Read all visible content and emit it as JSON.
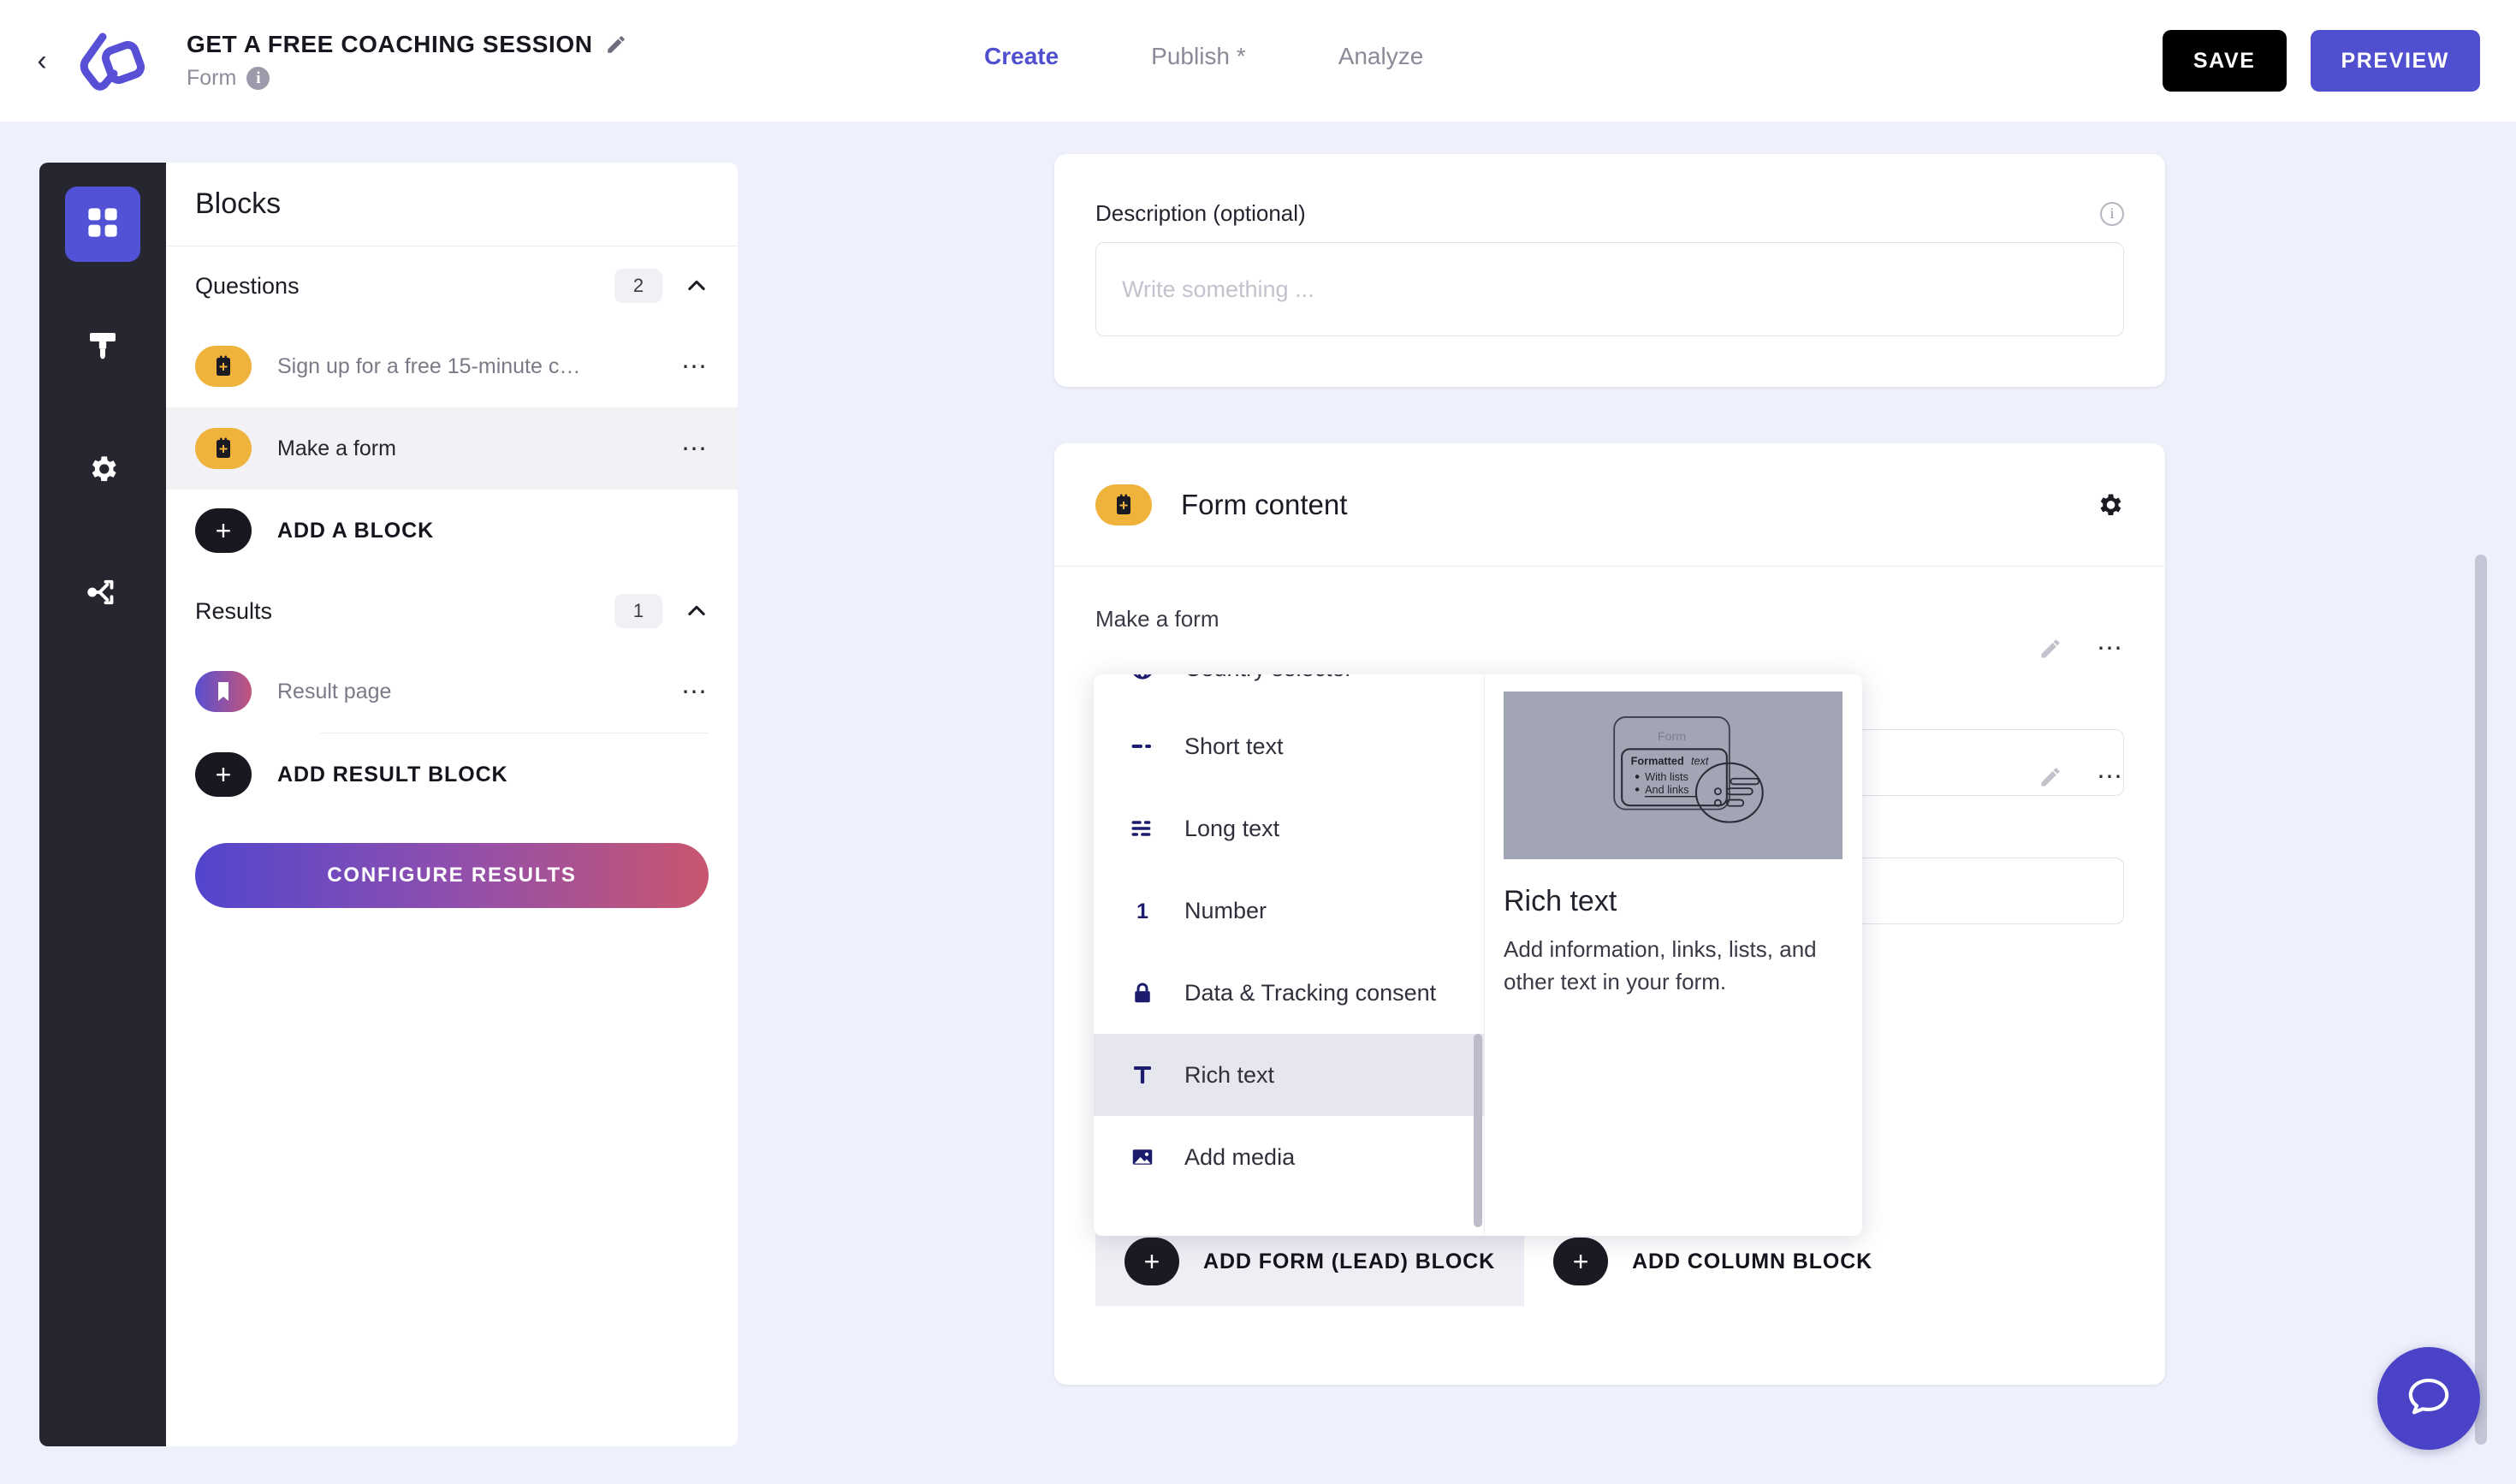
{
  "header": {
    "back_icon": "chevron-left-icon",
    "logo_icon": "brand-logo-icon",
    "title": "GET A FREE COACHING SESSION",
    "title_edit_icon": "pencil-icon",
    "subtitle": "Form",
    "subtitle_info_icon": "info-icon",
    "tabs": [
      {
        "label": "Create",
        "active": true
      },
      {
        "label": "Publish *",
        "active": false
      },
      {
        "label": "Analyze",
        "active": false
      }
    ],
    "save_label": "SAVE",
    "preview_label": "PREVIEW",
    "accent_color": "#4f4fd0",
    "save_color": "#000000"
  },
  "rail": {
    "items": [
      {
        "icon": "grid-blocks-icon",
        "active": true
      },
      {
        "icon": "paint-brush-icon",
        "active": false
      },
      {
        "icon": "gear-icon",
        "active": false
      },
      {
        "icon": "share-branch-icon",
        "active": false
      }
    ]
  },
  "blocks_panel": {
    "title": "Blocks",
    "questions": {
      "label": "Questions",
      "count": "2",
      "collapse_icon": "chevron-up-icon",
      "items": [
        {
          "label": "Sign up for a free 15-minute c…",
          "icon": "form-block-icon",
          "selected": false,
          "menu_icon": "ellipsis-icon"
        },
        {
          "label": "Make a form",
          "icon": "form-block-icon",
          "selected": true,
          "menu_icon": "ellipsis-icon"
        }
      ],
      "add_label": "ADD A BLOCK",
      "add_icon": "plus-icon"
    },
    "results": {
      "label": "Results",
      "count": "1",
      "collapse_icon": "chevron-up-icon",
      "items": [
        {
          "label": "Result page",
          "icon": "bookmark-icon",
          "selected": false,
          "menu_icon": "ellipsis-icon"
        }
      ],
      "add_label": "ADD RESULT BLOCK",
      "add_icon": "plus-icon"
    },
    "configure_label": "CONFIGURE RESULTS"
  },
  "description_card": {
    "label": "Description (optional)",
    "info_icon": "info-icon",
    "placeholder": "Write something ...",
    "value": ""
  },
  "form_card": {
    "icon": "form-block-icon",
    "title": "Form content",
    "settings_icon": "gear-icon",
    "subtitle": "Make a form",
    "ghost_rows": [
      {
        "edit_icon": "pencil-icon",
        "menu_icon": "ellipsis-icon"
      },
      {
        "edit_icon": "pencil-icon",
        "menu_icon": "ellipsis-icon"
      }
    ],
    "footer": [
      {
        "label": "ADD FORM (LEAD) BLOCK",
        "icon": "plus-icon",
        "hovered": true
      },
      {
        "label": "ADD COLUMN BLOCK",
        "icon": "plus-icon",
        "hovered": false
      }
    ]
  },
  "block_menu": {
    "items": [
      {
        "label": "Country selector",
        "icon": "globe-icon",
        "highlighted": false,
        "clipped": true
      },
      {
        "label": "Short text",
        "icon": "short-text-icon",
        "highlighted": false,
        "clipped": false
      },
      {
        "label": "Long text",
        "icon": "long-text-icon",
        "highlighted": false,
        "clipped": false
      },
      {
        "label": "Number",
        "icon": "number-one-icon",
        "highlighted": false,
        "clipped": false
      },
      {
        "label": "Data & Tracking consent",
        "icon": "lock-icon",
        "highlighted": false,
        "clipped": false
      },
      {
        "label": "Rich text",
        "icon": "text-format-t-icon",
        "highlighted": true,
        "clipped": false
      },
      {
        "label": "Add media",
        "icon": "image-icon",
        "highlighted": false,
        "clipped": false
      }
    ],
    "scrollbar_icon": "menu-scrollbar",
    "preview": {
      "thumbnail_icon": "rich-text-illustration",
      "thumb_form_label": "Form",
      "thumb_bold_word": "Formatted",
      "thumb_italic_word": "text",
      "thumb_bullets": [
        "With lists",
        "And links"
      ],
      "title": "Rich text",
      "description": "Add information, links, lists, and other text in your form."
    }
  },
  "chat": {
    "icon": "chat-bubble-icon",
    "color": "#4a43c8"
  },
  "scrollbar": {
    "icon": "page-scrollbar"
  }
}
